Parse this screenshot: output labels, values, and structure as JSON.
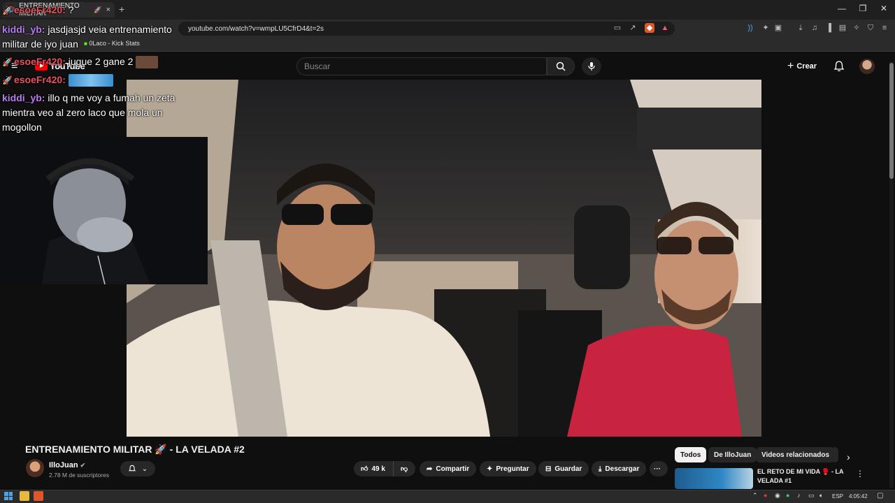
{
  "browser": {
    "tab_title": "ENTRENAMIENTO MILITAR",
    "tab_close": "×",
    "new_tab": "+",
    "url": "youtube.com/watch?v=wmpLU5CfrD4&t=2s",
    "bookmark": "0Laco - Kick Stats",
    "window_controls": [
      "—",
      "❐",
      "✕"
    ]
  },
  "youtube": {
    "logo_text": "YouTube",
    "search_placeholder": "Buscar",
    "create_label": "Crear",
    "video": {
      "title": "ENTRENAMIENTO MILITAR 🚀  - LA VELADA #2",
      "channel": "IlloJuan",
      "subscribers": "2.78 M de suscriptores",
      "likes": "49 k",
      "share_label": "Compartir",
      "ask_label": "Preguntar",
      "save_label": "Guardar",
      "download_label": "Descargar",
      "more_label": "···"
    },
    "chips": [
      "Todos",
      "De IlloJuan",
      "Videos relacionados"
    ],
    "recommended": {
      "title": "EL RETO DE MI VIDA 🥊 - LA VELADA #1"
    }
  },
  "chat": [
    {
      "user": "esoeFr420:",
      "text": "?"
    },
    {
      "user": "kiddi_yb:",
      "text": "jasdjasjd veia entrenamiento militar de iyo juan"
    },
    {
      "user": "esoeFr420:",
      "text": "jugue 2 gane 2"
    },
    {
      "user": "esoeFr420:",
      "text": ""
    },
    {
      "user": "kiddi_yb:",
      "text": "illo q me voy a fumah un zeta mientra veo al zero laco que mola un mogollon"
    }
  ],
  "taskbar": {
    "language": "ESP",
    "time": "4:05:42"
  },
  "colors": {
    "youtube_red": "#ff0000",
    "chat_user_esoe": "#e8525e",
    "chat_user_kiddi": "#b77cf2",
    "background": "#0f0f0f"
  }
}
